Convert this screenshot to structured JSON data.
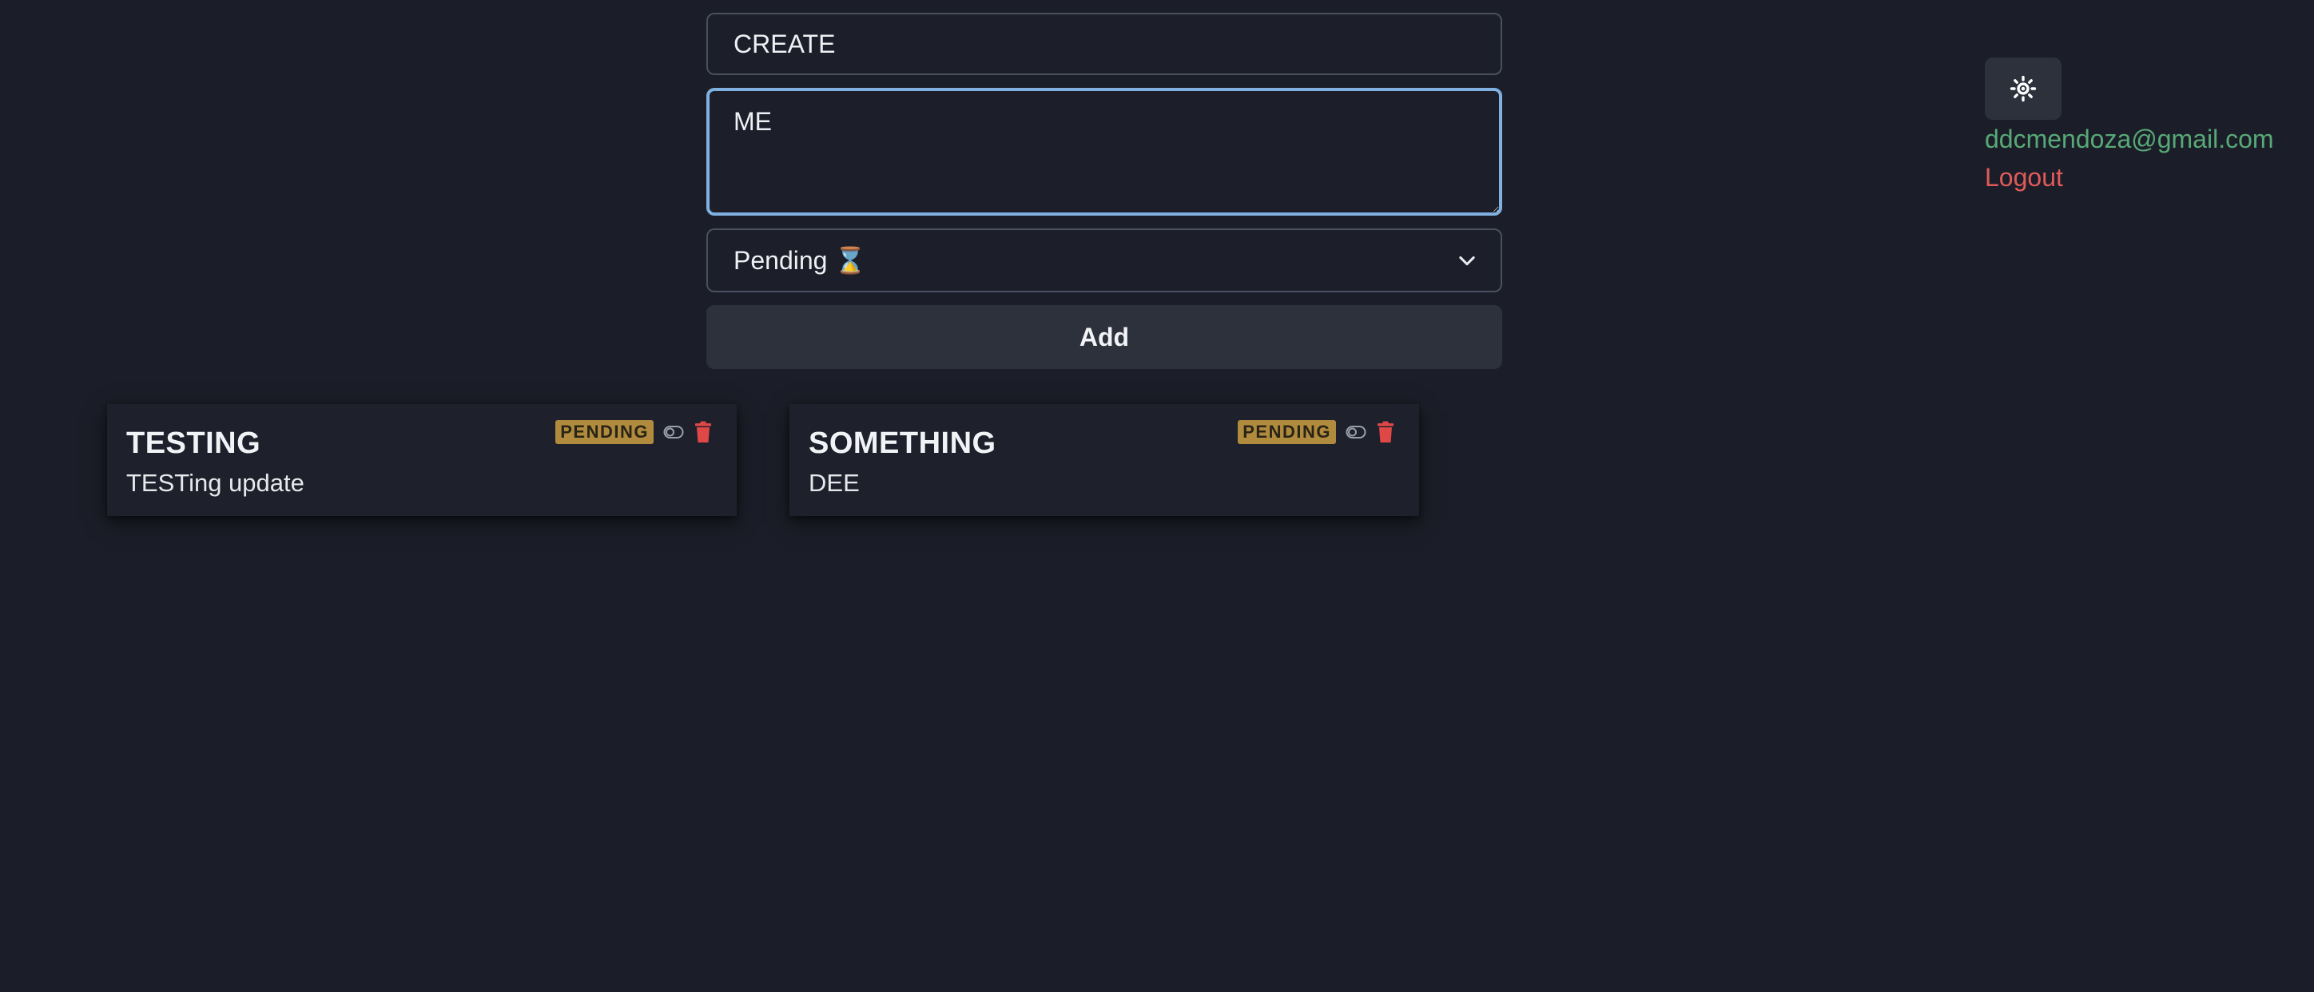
{
  "form": {
    "title_value": "CREATE",
    "description_value": "ME",
    "status_selected": "Pending ⌛",
    "add_label": "Add"
  },
  "user": {
    "email": "ddcmendoza@gmail.com",
    "logout_label": "Logout"
  },
  "icons": {
    "theme_toggle": "sun-icon",
    "status_dropdown": "chevron-down-icon",
    "card_toggle": "toggle-icon",
    "card_delete": "trash-icon"
  },
  "colors": {
    "background": "#1b1e28",
    "focus_border": "#7fb0e0",
    "email": "#58a977",
    "logout": "#e05a5a",
    "badge": "#b08b3e",
    "delete": "#e04848"
  },
  "todos": [
    {
      "title": "TESTING",
      "description": "TESTing update",
      "status": "PENDING"
    },
    {
      "title": "SOMETHING",
      "description": "DEE",
      "status": "PENDING"
    }
  ]
}
